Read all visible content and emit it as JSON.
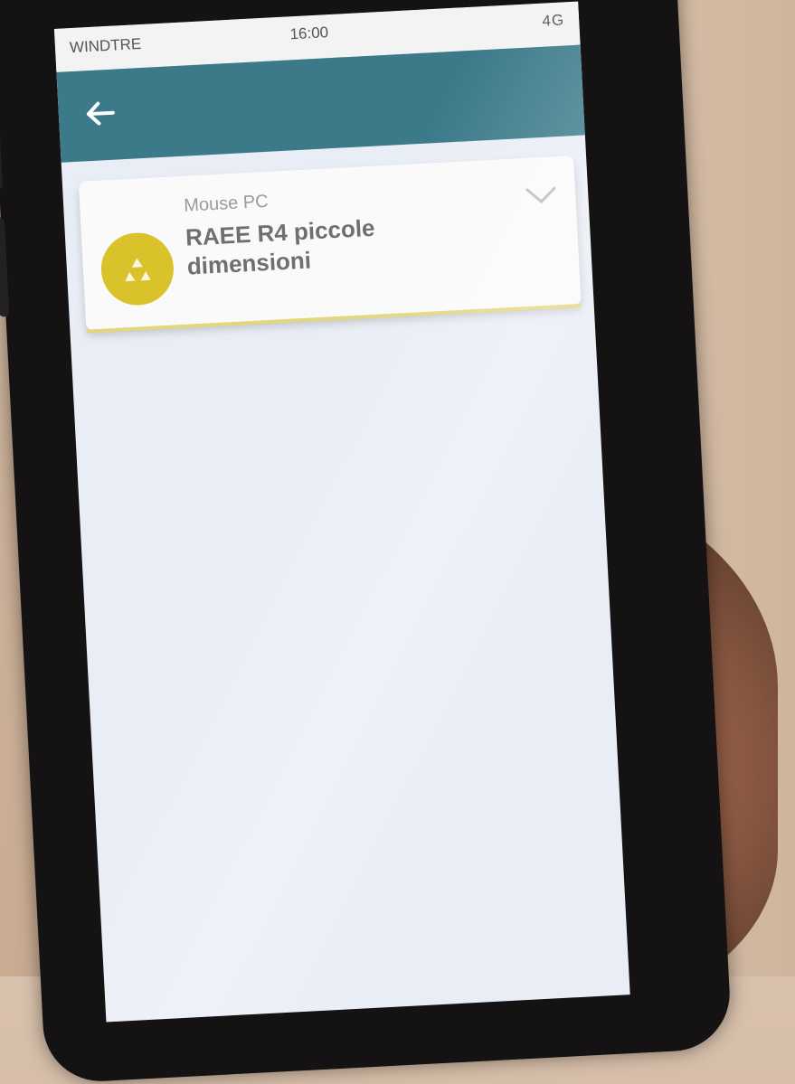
{
  "status_bar": {
    "carrier": "WINDTRE",
    "time": "16:00",
    "right": "4G"
  },
  "app_bar": {
    "back_icon": "back-arrow-icon"
  },
  "item_card": {
    "subtitle": "Mouse PC",
    "title": "RAEE R4 piccole dimensioni",
    "badge_icon": "recycle-icon",
    "chevron_icon": "chevron-down-icon"
  },
  "colors": {
    "app_bar": "#3c7a8a",
    "badge": "#d9c22a",
    "screen_bg": "#e9edf5"
  }
}
